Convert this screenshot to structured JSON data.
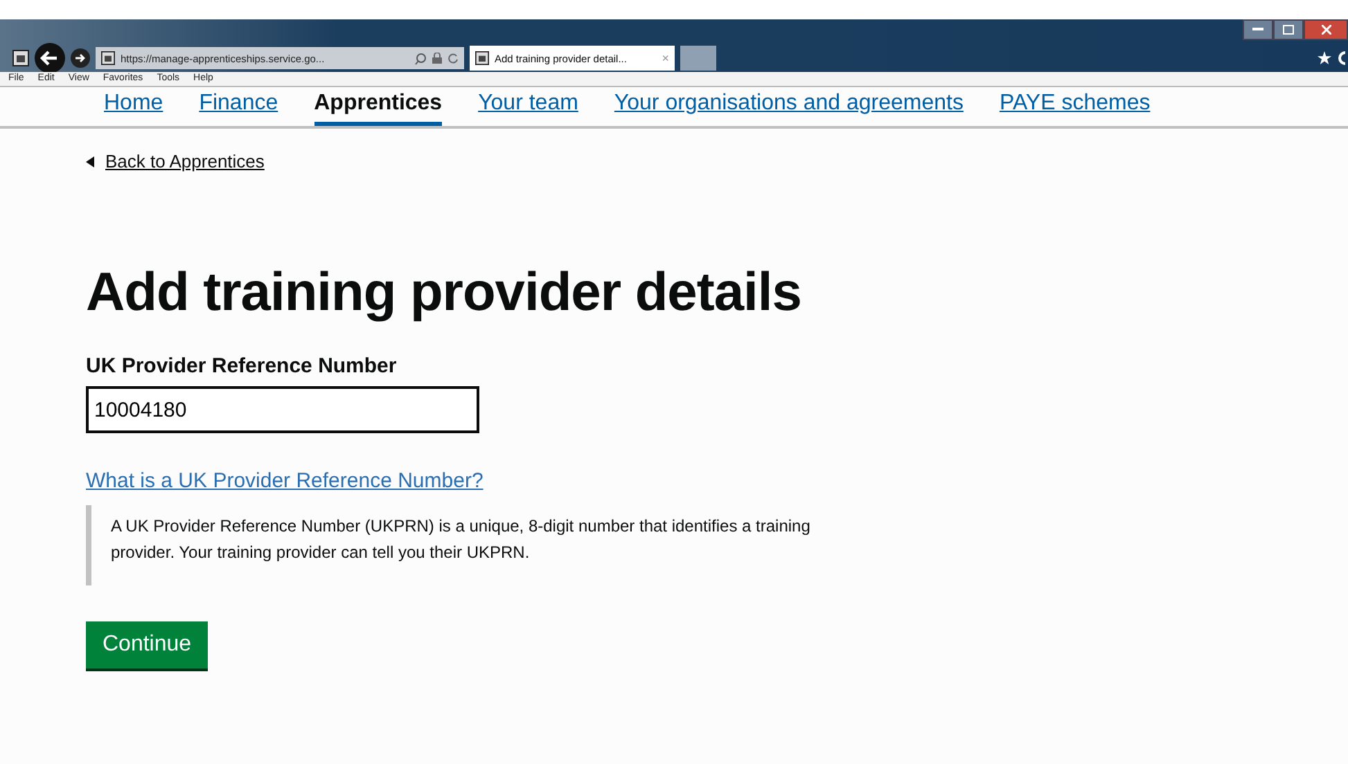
{
  "browser": {
    "address": "https://manage-apprenticeships.service.go...",
    "tab": {
      "title": "Add training provider detail...",
      "close": "×"
    },
    "menu": [
      "File",
      "Edit",
      "View",
      "Favorites",
      "Tools",
      "Help"
    ]
  },
  "nav": [
    {
      "label": "Home",
      "selected": false
    },
    {
      "label": "Finance",
      "selected": false
    },
    {
      "label": "Apprentices",
      "selected": true
    },
    {
      "label": "Your team",
      "selected": false
    },
    {
      "label": "Your organisations and agreements",
      "selected": false
    },
    {
      "label": "PAYE schemes",
      "selected": false
    }
  ],
  "back_link": "Back to Apprentices",
  "heading": "Add training provider details",
  "field": {
    "label": "UK Provider Reference Number",
    "value": "10004180"
  },
  "details": {
    "summary": "What is a UK Provider Reference Number?",
    "text": "A UK Provider Reference Number (UKPRN) is a unique, 8-digit number that identifies a training provider. Your training provider can tell you their UKPRN."
  },
  "button": "Continue"
}
